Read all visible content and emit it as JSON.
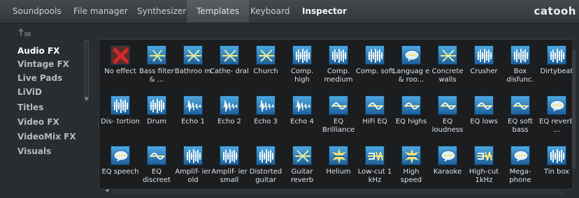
{
  "tabs": [
    "Soundpools",
    "File manager",
    "Synthesizer",
    "Templates",
    "Keyboard",
    "Inspector"
  ],
  "brand": "catooh",
  "sidebar": {
    "items": [
      "Audio FX",
      "Vintage FX",
      "Live Pads",
      "LiViD",
      "Titles",
      "Video FX",
      "VideoMix FX",
      "Visuals"
    ]
  },
  "grid": {
    "items": [
      {
        "label": "No effect",
        "icon": "no-effect-icon"
      },
      {
        "label": "Bass filter & ...",
        "icon": "filter-icon"
      },
      {
        "label": "Bathroo m",
        "icon": "reverb-icon"
      },
      {
        "label": "Cathe- dral",
        "icon": "reverb-icon"
      },
      {
        "label": "Church",
        "icon": "reverb-icon"
      },
      {
        "label": "Comp. high",
        "icon": "waveform-icon"
      },
      {
        "label": "Comp. medium",
        "icon": "waveform-icon"
      },
      {
        "label": "Comp. soft",
        "icon": "waveform-icon"
      },
      {
        "label": "Languag e & roo...",
        "icon": "speech-icon"
      },
      {
        "label": "Concrete walls",
        "icon": "reverb-icon"
      },
      {
        "label": "Crusher",
        "icon": "waveform-icon"
      },
      {
        "label": "Box disfunc.",
        "icon": "waveform-icon"
      },
      {
        "label": "Dirtybeat",
        "icon": "waveform-icon"
      },
      {
        "label": "Dis- tortion",
        "icon": "waveform-icon"
      },
      {
        "label": "Drum",
        "icon": "waveform-icon"
      },
      {
        "label": "Echo 1",
        "icon": "echo-icon"
      },
      {
        "label": "Echo 2",
        "icon": "echo-icon"
      },
      {
        "label": "Echo 3",
        "icon": "echo-icon"
      },
      {
        "label": "Echo 4",
        "icon": "echo-icon"
      },
      {
        "label": "EQ Brilliance",
        "icon": "eq-icon"
      },
      {
        "label": "HiFi EQ",
        "icon": "eq-icon"
      },
      {
        "label": "EQ highs",
        "icon": "eq-icon"
      },
      {
        "label": "EQ loudness",
        "icon": "eq-icon"
      },
      {
        "label": "EQ lows",
        "icon": "eq-icon"
      },
      {
        "label": "EQ soft bass",
        "icon": "eq-icon"
      },
      {
        "label": "EQ reverb ...",
        "icon": "speech-icon"
      },
      {
        "label": "EQ speech",
        "icon": "speech-icon"
      },
      {
        "label": "EQ discreet",
        "icon": "eq-icon"
      },
      {
        "label": "Amplif- ier old",
        "icon": "waveform-icon"
      },
      {
        "label": "Amplif- ier small",
        "icon": "waveform-icon"
      },
      {
        "label": "Distorted guitar",
        "icon": "waveform-icon"
      },
      {
        "label": "Guitar reverb",
        "icon": "reverb-icon"
      },
      {
        "label": "Helium",
        "icon": "burst-icon"
      },
      {
        "label": "Low-cut 1 kHz",
        "icon": "cut-icon"
      },
      {
        "label": "High speed",
        "icon": "burst-icon"
      },
      {
        "label": "Karaoke",
        "icon": "speech-icon"
      },
      {
        "label": "High-cut 1kHz",
        "icon": "cut-icon"
      },
      {
        "label": "Mega- phone",
        "icon": "speech-icon"
      },
      {
        "label": "Tin box",
        "icon": "waveform-icon"
      }
    ]
  },
  "colors": {
    "accent": "#3f8fd0",
    "background": "#2a2d30",
    "panel": "#1b1d1f"
  }
}
